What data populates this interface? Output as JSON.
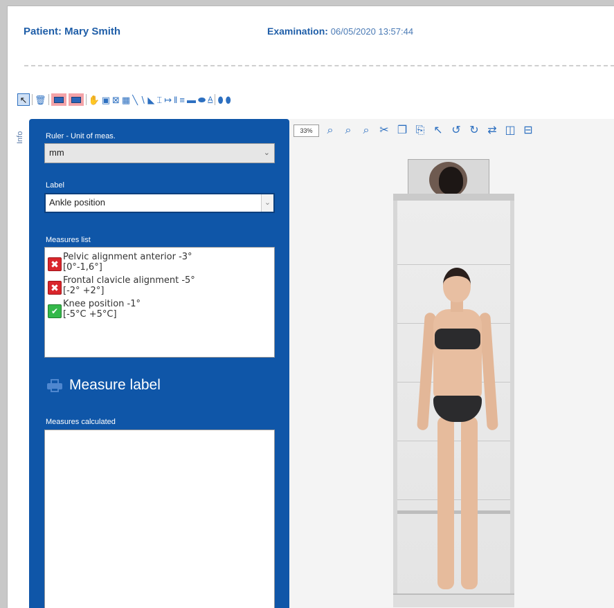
{
  "header": {
    "patient_label": "Patient: Mary Smith",
    "exam_label": "Examination:",
    "exam_datetime": "06/05/2020 13:57:44"
  },
  "side_tab": {
    "label": "Info"
  },
  "panel": {
    "ruler_label": "Ruler - Unit of meas.",
    "ruler_value": "mm",
    "label_label": "Label",
    "label_value": "Ankle position",
    "measures_list_label": "Measures list",
    "measures": [
      {
        "status": "fail",
        "name": "Pelvic alignment anterior -3°",
        "range": "[0°-1,6°]"
      },
      {
        "status": "fail",
        "name": "Frontal clavicle alignment -5°",
        "range": "[-2° +2°]"
      },
      {
        "status": "ok",
        "name": "Knee position -1°",
        "range": "[-5°C +5°C]"
      }
    ],
    "measure_label_button": "Measure label",
    "measures_calculated_label": "Measures calculated"
  },
  "viewer": {
    "zoom": "33%"
  },
  "colors": {
    "panel_blue": "#0f56a8",
    "header_blue": "#1f5ea8",
    "fail_red": "#d9262c",
    "ok_green": "#34b84a"
  },
  "icons": {
    "toolbar": [
      "pointer-icon",
      "delete-icon",
      "rect-view-icon",
      "rect-view-alt-icon",
      "hand-icon",
      "select-region-icon",
      "region-cross-icon",
      "region-grid-icon",
      "line-icon",
      "angle-line-icon",
      "right-angle-icon",
      "vertical-ruler-icon",
      "horizontal-ruler-icon",
      "grid-vertical-icon",
      "grid-horizontal-icon",
      "rectangle-fill-icon",
      "ellipse-fill-icon",
      "text-icon",
      "foot-left-icon",
      "foot-right-icon"
    ],
    "viewer_toolbar": [
      "zoom-icon",
      "zoom-in-icon",
      "zoom-out-icon",
      "zoom-fit-icon",
      "cut-icon",
      "copy-icon",
      "paste-icon",
      "cursor-icon",
      "rotate-left-icon",
      "rotate-right-icon",
      "flip-icon",
      "split-vertical-icon",
      "split-horizontal-icon"
    ]
  }
}
